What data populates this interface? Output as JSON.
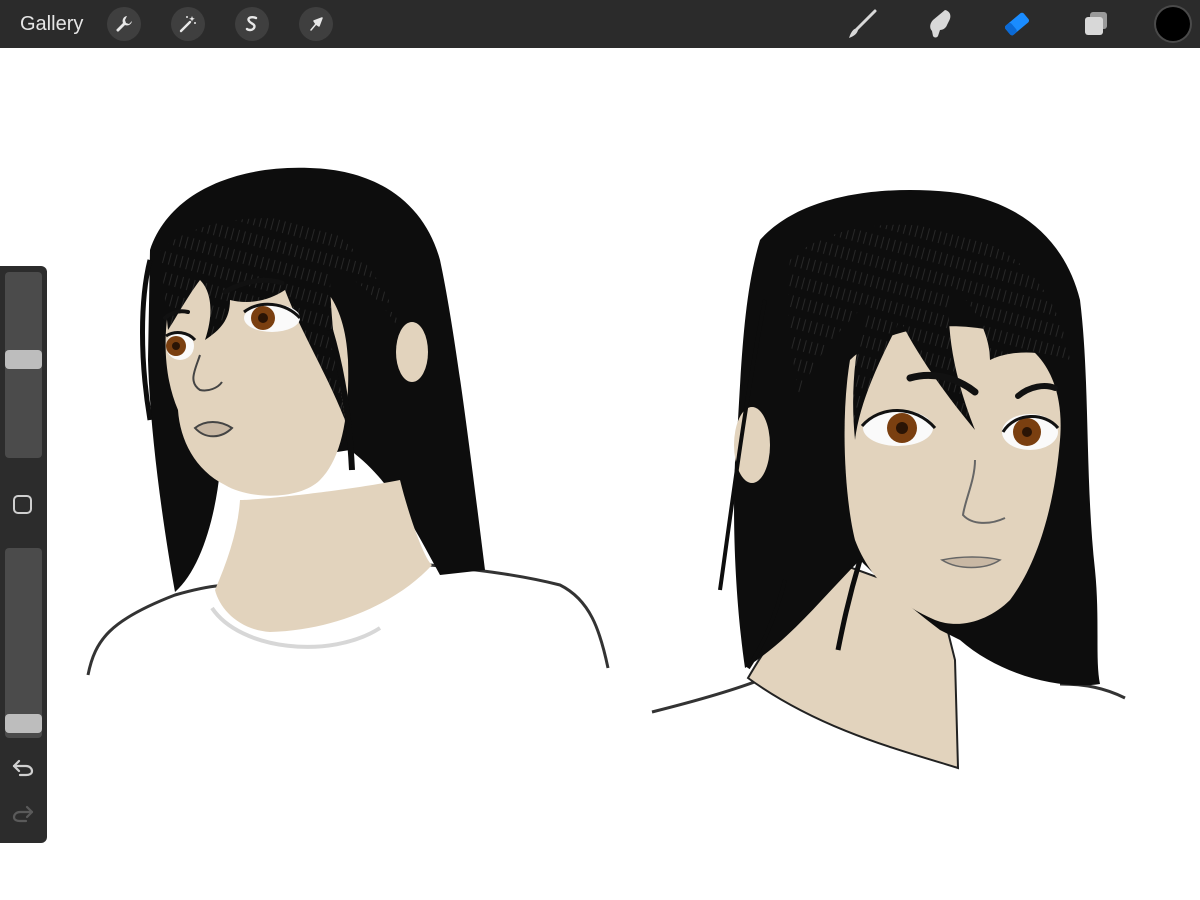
{
  "toolbar": {
    "gallery_label": "Gallery",
    "left_tools": [
      "wrench-icon",
      "magic-wand-icon",
      "selection-s-icon",
      "transform-arrow-icon"
    ],
    "right_tools": [
      "brush-icon",
      "smudge-icon",
      "eraser-icon",
      "layers-icon"
    ],
    "active_tool": "eraser",
    "current_color": "#000000"
  },
  "sidebar": {
    "brush_size_level": 0.53,
    "brush_opacity_level": 0.03,
    "undo_enabled": true,
    "redo_enabled": false
  },
  "colors": {
    "toolbar_bg": "#2b2b2b",
    "accent_blue": "#1a8cff",
    "skin": "#e2d3bd",
    "hair": "#0d0d0d",
    "iris": "#7a3f10"
  }
}
